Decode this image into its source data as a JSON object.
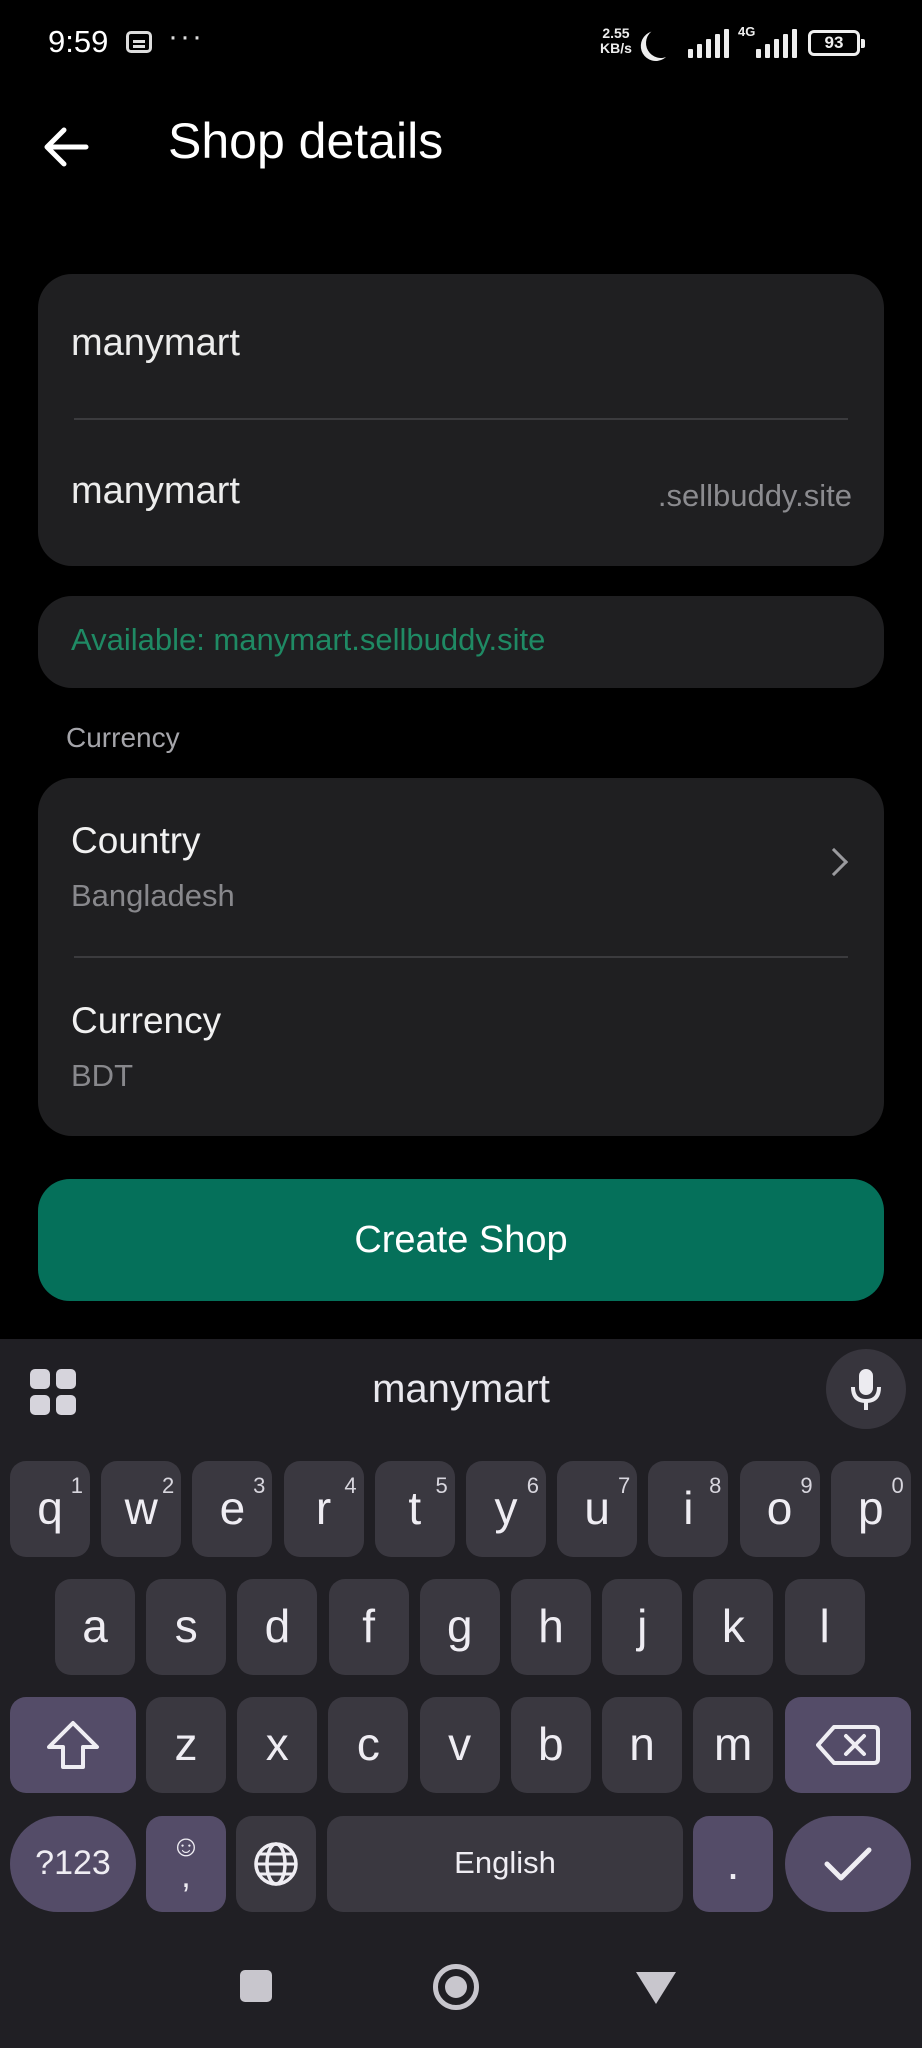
{
  "status_bar": {
    "time": "9:59",
    "dots": "···",
    "speed": "2.55\nKB/s",
    "speed_value": "2.55",
    "speed_unit": "KB/s",
    "network": "4G",
    "battery": "93"
  },
  "header": {
    "title": "Shop details"
  },
  "shop": {
    "name": "manymart",
    "subdomain": "manymart",
    "domain_suffix": ".sellbuddy.site",
    "availability": "Available: manymart.sellbuddy.site"
  },
  "currency_section": {
    "label": "Currency",
    "country_title": "Country",
    "country_value": "Bangladesh",
    "currency_title": "Currency",
    "currency_value": "BDT"
  },
  "actions": {
    "create_label": "Create Shop"
  },
  "colors": {
    "accent": "#05705a",
    "available_text": "#1f8a64"
  },
  "keyboard": {
    "suggestion": "manymart",
    "row1": [
      {
        "k": "q",
        "h": "1"
      },
      {
        "k": "w",
        "h": "2"
      },
      {
        "k": "e",
        "h": "3"
      },
      {
        "k": "r",
        "h": "4"
      },
      {
        "k": "t",
        "h": "5"
      },
      {
        "k": "y",
        "h": "6"
      },
      {
        "k": "u",
        "h": "7"
      },
      {
        "k": "i",
        "h": "8"
      },
      {
        "k": "o",
        "h": "9"
      },
      {
        "k": "p",
        "h": "0"
      }
    ],
    "row2": [
      "a",
      "s",
      "d",
      "f",
      "g",
      "h",
      "j",
      "k",
      "l"
    ],
    "row3": [
      "z",
      "x",
      "c",
      "v",
      "b",
      "n",
      "m"
    ],
    "symbols_label": "?123",
    "emoji_label": "☺",
    "comma_label": ",",
    "space_label": "English",
    "period_label": "."
  }
}
